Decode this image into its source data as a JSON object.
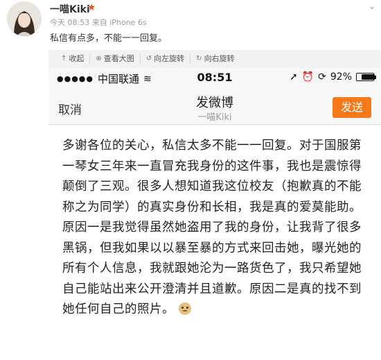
{
  "post": {
    "username": "一喵Kiki",
    "meta": "今天 08:53 来自 iPhone 6s",
    "text": "私信有点多，不能一一回复。",
    "menu_caret": "⌄"
  },
  "toolbar": {
    "items": [
      {
        "icon": "collapse-icon",
        "label": "收起"
      },
      {
        "icon": "zoom-icon",
        "label": "查看大图"
      },
      {
        "icon": "rotate-left-icon",
        "label": "向左旋转"
      },
      {
        "icon": "rotate-right-icon",
        "label": "向右旋转"
      }
    ]
  },
  "phone": {
    "carrier": "中国联通",
    "time": "08:51",
    "battery_text": "92%",
    "battery_level": 0.92,
    "nav": {
      "cancel": "取消",
      "title": "发微博",
      "subtitle": "一喵Kiki",
      "send": "发送"
    },
    "body": "多谢各位的关心，私信太多不能一一回复。对于国服第一琴女三年来一直冒充我身份的这件事，我也是震惊得颠倒了三观。很多人想知道我这位校友（抱歉真的不能称之为同学）的真实身份和长相，我是真的爱莫能助。原因一是我觉得虽然她盗用了我的身份，让我背了很多黑锅，但我如果以以暴至暴的方式来回击她，曝光她的所有个人信息，我就跟她沦为一路货色了，我只希望她自己能站出来公开澄清并且道歉。原因二是真的找不到她任何自己的照片。"
  },
  "colors": {
    "send_button": "#f5781a",
    "vip_badge": "#e8541e",
    "toolbar_bg": "#f2f2f2"
  }
}
